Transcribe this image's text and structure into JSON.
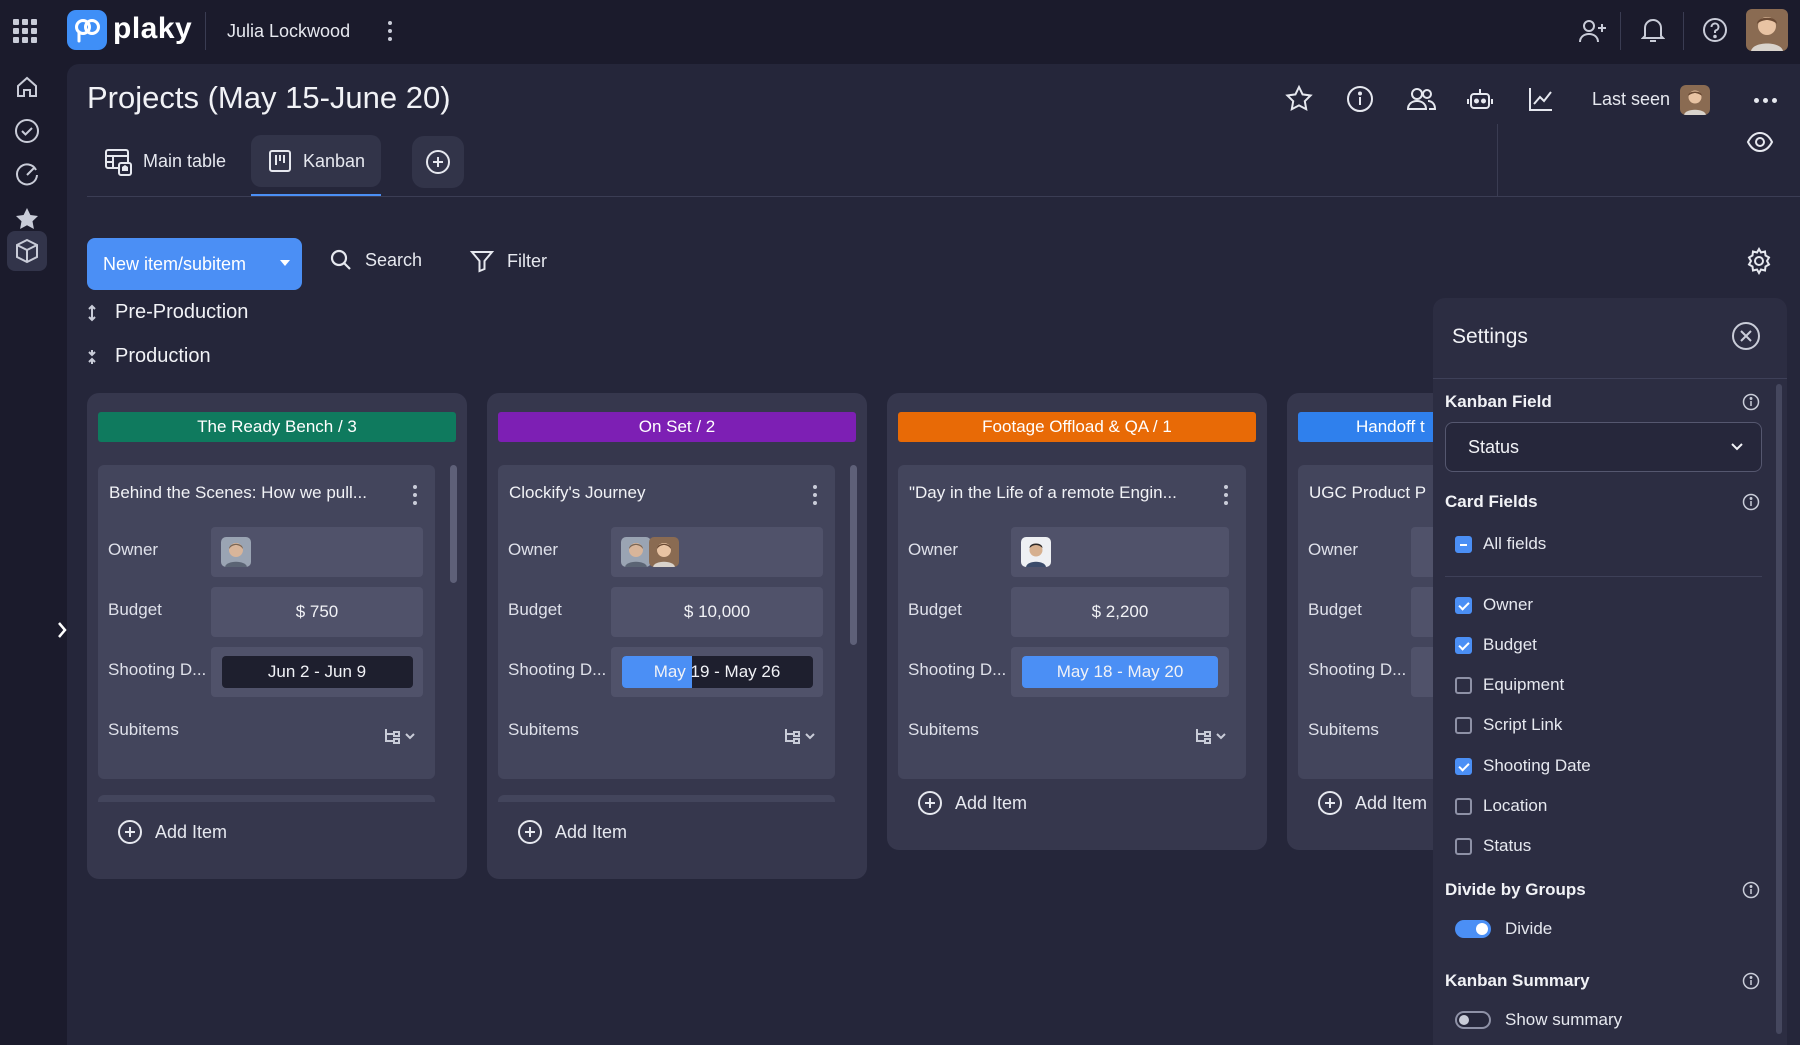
{
  "app": {
    "logo_text": "plaky",
    "workspace": "Julia Lockwood"
  },
  "board": {
    "title": "Projects (May 15-June 20)",
    "last_seen_label": "Last seen"
  },
  "views": {
    "main_table": "Main table",
    "kanban": "Kanban"
  },
  "toolbar": {
    "new_item": "New item/subitem",
    "search": "Search",
    "filter": "Filter"
  },
  "groups": {
    "pre_production": "Pre-Production",
    "production": "Production"
  },
  "columns": [
    {
      "header": "The Ready Bench / 3",
      "color": "#0f7a5e",
      "card": {
        "title": "Behind the Scenes: How we pull...",
        "owner_label": "Owner",
        "budget_label": "Budget",
        "budget": "$ 750",
        "date_label": "Shooting D...",
        "date": "Jun 2 - Jun 9",
        "subitems_label": "Subitems"
      },
      "add_item": "Add Item"
    },
    {
      "header": "On Set / 2",
      "color": "#7d1fb4",
      "card": {
        "title": "Clockify's Journey",
        "owner_label": "Owner",
        "budget_label": "Budget",
        "budget": "$ 10,000",
        "date_label": "Shooting D...",
        "date": "May 19 - May 26",
        "subitems_label": "Subitems"
      },
      "add_item": "Add Item"
    },
    {
      "header": "Footage Offload & QA / 1",
      "color": "#e86a06",
      "card": {
        "title": "\"Day in the Life of a remote Engin...",
        "owner_label": "Owner",
        "budget_label": "Budget",
        "budget": "$ 2,200",
        "date_label": "Shooting D...",
        "date": "May 18 - May 20",
        "subitems_label": "Subitems"
      },
      "add_item": "Add Item"
    },
    {
      "header": "Handoff t",
      "color": "#2f80ed",
      "card": {
        "title": "UGC Product P",
        "owner_label": "Owner",
        "budget_label": "Budget",
        "date_label": "Shooting D...",
        "subitems_label": "Subitems"
      },
      "add_item": "Add Item"
    }
  ],
  "settings": {
    "title": "Settings",
    "kanban_field_label": "Kanban Field",
    "kanban_field_value": "Status",
    "card_fields_label": "Card Fields",
    "all_fields": "All fields",
    "fields": [
      {
        "label": "Owner",
        "checked": true
      },
      {
        "label": "Budget",
        "checked": true
      },
      {
        "label": "Equipment",
        "checked": false
      },
      {
        "label": "Script Link",
        "checked": false
      },
      {
        "label": "Shooting Date",
        "checked": true
      },
      {
        "label": "Location",
        "checked": false
      },
      {
        "label": "Status",
        "checked": false
      }
    ],
    "divide_label": "Divide by Groups",
    "divide_toggle": "Divide",
    "divide_on": true,
    "summary_label": "Kanban Summary",
    "summary_toggle": "Show summary",
    "summary_on": false
  }
}
